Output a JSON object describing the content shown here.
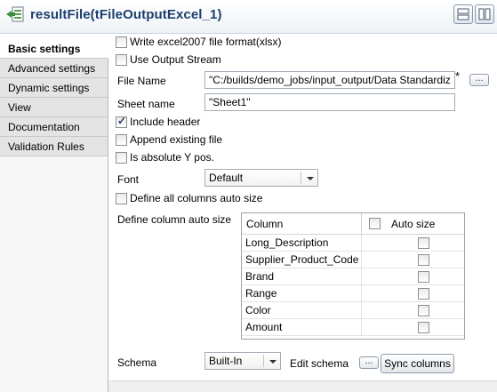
{
  "header": {
    "title": "resultFile(tFileOutputExcel_1)",
    "component_icon": "excel-output-icon",
    "view_buttons": [
      "layout-single-icon",
      "layout-split-icon"
    ]
  },
  "sidebar": {
    "tabs": [
      {
        "label": "Basic settings",
        "active": true
      },
      {
        "label": "Advanced settings"
      },
      {
        "label": "Dynamic settings"
      },
      {
        "label": "View"
      },
      {
        "label": "Documentation"
      },
      {
        "label": "Validation Rules"
      }
    ]
  },
  "form": {
    "write_excel2007": {
      "label": "Write excel2007 file format(xlsx)",
      "checked": false
    },
    "use_output_stream": {
      "label": "Use Output Stream",
      "checked": false
    },
    "file_name": {
      "label": "File Name",
      "value": "\"C:/builds/demo_jobs/input_output/Data Standardiz",
      "required_mark": "*",
      "browse_label": "..."
    },
    "sheet_name": {
      "label": "Sheet name",
      "value": "\"Sheet1\""
    },
    "include_header": {
      "label": "Include header",
      "checked": true
    },
    "append_existing": {
      "label": "Append existing file",
      "checked": false
    },
    "absolute_y": {
      "label": "Is absolute Y pos.",
      "checked": false
    },
    "font": {
      "label": "Font",
      "value": "Default"
    },
    "define_all_auto_size": {
      "label": "Define all columns auto size",
      "checked": false
    },
    "define_column_auto_size": {
      "label": "Define column auto size"
    }
  },
  "table": {
    "headers": {
      "column": "Column",
      "auto_size": "Auto size"
    },
    "rows": [
      {
        "column": "Long_Description",
        "auto_size": false
      },
      {
        "column": "Supplier_Product_Code",
        "auto_size": false
      },
      {
        "column": "Brand",
        "auto_size": false
      },
      {
        "column": "Range",
        "auto_size": false
      },
      {
        "column": "Color",
        "auto_size": false
      },
      {
        "column": "Amount",
        "auto_size": false
      }
    ]
  },
  "schema": {
    "label": "Schema",
    "value": "Built-In",
    "edit_label": "Edit schema",
    "edit_button": "...",
    "sync_label": "Sync columns"
  }
}
